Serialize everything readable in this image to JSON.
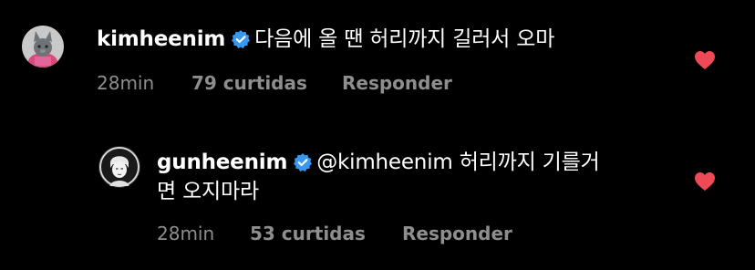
{
  "comments": [
    {
      "username": "kimheenim",
      "verified": true,
      "text": "다음에 올 땐 허리까지 길러서 오마",
      "time": "28min",
      "likes": "79 curtidas",
      "reply_label": "Responder",
      "liked": true
    },
    {
      "username": "gunheenim",
      "verified": true,
      "mention": "@kimheenim",
      "text_line1": "허리까지 기를거",
      "text_line2": "면 오지마라",
      "time": "28min",
      "likes": "53 curtidas",
      "reply_label": "Responder",
      "liked": true
    }
  ],
  "colors": {
    "background": "#000000",
    "text": "#ffffff",
    "secondary": "#8e8e8e",
    "verified": "#3897f0",
    "heart": "#ed4956"
  },
  "icons": {
    "verified": "verified-badge-icon",
    "heart": "heart-filled-icon"
  }
}
